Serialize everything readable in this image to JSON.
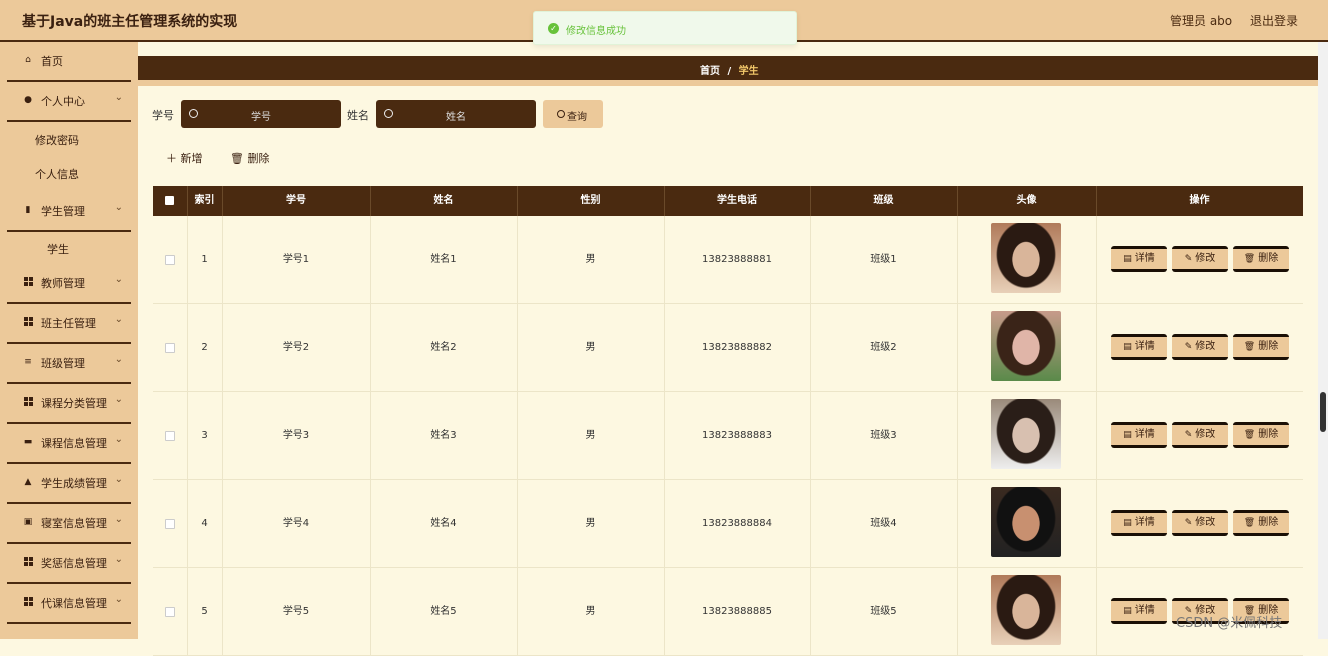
{
  "app": {
    "title": "基于Java的班主任管理系统的实现",
    "user_label": "管理员 abo",
    "logout_label": "退出登录"
  },
  "toast": {
    "message": "修改信息成功"
  },
  "sidebar": {
    "items": [
      {
        "label": "首页",
        "icon": "home-icon"
      },
      {
        "label": "个人中心",
        "icon": "user-icon"
      },
      {
        "label": "学生管理",
        "icon": "bar-chart-icon"
      },
      {
        "label": "教师管理",
        "icon": "grid-icon"
      },
      {
        "label": "班主任管理",
        "icon": "grid-icon"
      },
      {
        "label": "班级管理",
        "icon": "list-icon"
      },
      {
        "label": "课程分类管理",
        "icon": "grid-icon"
      },
      {
        "label": "课程信息管理",
        "icon": "briefcase-icon"
      },
      {
        "label": "学生成绩管理",
        "icon": "thumb-icon"
      },
      {
        "label": "寝室信息管理",
        "icon": "bed-icon"
      },
      {
        "label": "奖惩信息管理",
        "icon": "grid-icon"
      },
      {
        "label": "代课信息管理",
        "icon": "grid-icon"
      }
    ],
    "personal_sub": [
      "修改密码",
      "个人信息"
    ],
    "student_sub": [
      "学生"
    ]
  },
  "breadcrumb": {
    "home": "首页",
    "sep": "/",
    "current": "学生"
  },
  "search": {
    "id_label": "学号",
    "id_placeholder": "学号",
    "name_label": "姓名",
    "name_placeholder": "姓名",
    "query_label": "查询"
  },
  "actions": {
    "add_label": "新增",
    "delete_label": "删除"
  },
  "table": {
    "headers": [
      "索引",
      "学号",
      "姓名",
      "性别",
      "学生电话",
      "班级",
      "头像",
      "操作"
    ],
    "rows": [
      {
        "index": "1",
        "id": "学号1",
        "name": "姓名1",
        "gender": "男",
        "phone": "13823888881",
        "class": "班级1"
      },
      {
        "index": "2",
        "id": "学号2",
        "name": "姓名2",
        "gender": "男",
        "phone": "13823888882",
        "class": "班级2"
      },
      {
        "index": "3",
        "id": "学号3",
        "name": "姓名3",
        "gender": "男",
        "phone": "13823888883",
        "class": "班级3"
      },
      {
        "index": "4",
        "id": "学号4",
        "name": "姓名4",
        "gender": "男",
        "phone": "13823888884",
        "class": "班级4"
      },
      {
        "index": "5",
        "id": "学号5",
        "name": "姓名5",
        "gender": "男",
        "phone": "13823888885",
        "class": "班级5"
      }
    ],
    "row_buttons": {
      "detail": "详情",
      "edit": "修改",
      "delete": "删除"
    }
  },
  "watermark": "CSDN @米佩科技",
  "colors": {
    "header_bg": "#ecc99a",
    "dark_brown": "#4a2a10",
    "content_bg": "#fdf8e1",
    "success": "#67c23a"
  }
}
